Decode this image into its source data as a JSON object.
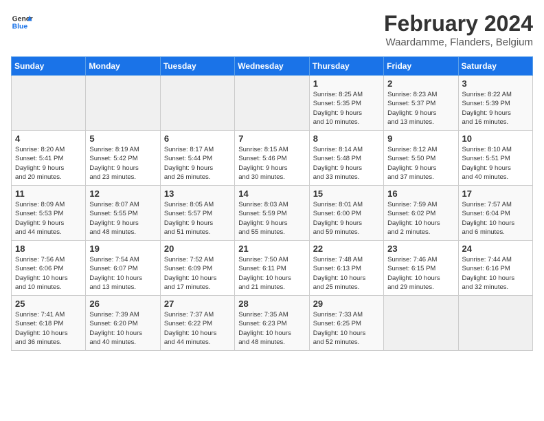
{
  "header": {
    "logo_general": "General",
    "logo_blue": "Blue",
    "title": "February 2024",
    "subtitle": "Waardamme, Flanders, Belgium"
  },
  "calendar": {
    "days_of_week": [
      "Sunday",
      "Monday",
      "Tuesday",
      "Wednesday",
      "Thursday",
      "Friday",
      "Saturday"
    ],
    "weeks": [
      [
        {
          "day": "",
          "info": ""
        },
        {
          "day": "",
          "info": ""
        },
        {
          "day": "",
          "info": ""
        },
        {
          "day": "",
          "info": ""
        },
        {
          "day": "1",
          "info": "Sunrise: 8:25 AM\nSunset: 5:35 PM\nDaylight: 9 hours\nand 10 minutes."
        },
        {
          "day": "2",
          "info": "Sunrise: 8:23 AM\nSunset: 5:37 PM\nDaylight: 9 hours\nand 13 minutes."
        },
        {
          "day": "3",
          "info": "Sunrise: 8:22 AM\nSunset: 5:39 PM\nDaylight: 9 hours\nand 16 minutes."
        }
      ],
      [
        {
          "day": "4",
          "info": "Sunrise: 8:20 AM\nSunset: 5:41 PM\nDaylight: 9 hours\nand 20 minutes."
        },
        {
          "day": "5",
          "info": "Sunrise: 8:19 AM\nSunset: 5:42 PM\nDaylight: 9 hours\nand 23 minutes."
        },
        {
          "day": "6",
          "info": "Sunrise: 8:17 AM\nSunset: 5:44 PM\nDaylight: 9 hours\nand 26 minutes."
        },
        {
          "day": "7",
          "info": "Sunrise: 8:15 AM\nSunset: 5:46 PM\nDaylight: 9 hours\nand 30 minutes."
        },
        {
          "day": "8",
          "info": "Sunrise: 8:14 AM\nSunset: 5:48 PM\nDaylight: 9 hours\nand 33 minutes."
        },
        {
          "day": "9",
          "info": "Sunrise: 8:12 AM\nSunset: 5:50 PM\nDaylight: 9 hours\nand 37 minutes."
        },
        {
          "day": "10",
          "info": "Sunrise: 8:10 AM\nSunset: 5:51 PM\nDaylight: 9 hours\nand 40 minutes."
        }
      ],
      [
        {
          "day": "11",
          "info": "Sunrise: 8:09 AM\nSunset: 5:53 PM\nDaylight: 9 hours\nand 44 minutes."
        },
        {
          "day": "12",
          "info": "Sunrise: 8:07 AM\nSunset: 5:55 PM\nDaylight: 9 hours\nand 48 minutes."
        },
        {
          "day": "13",
          "info": "Sunrise: 8:05 AM\nSunset: 5:57 PM\nDaylight: 9 hours\nand 51 minutes."
        },
        {
          "day": "14",
          "info": "Sunrise: 8:03 AM\nSunset: 5:59 PM\nDaylight: 9 hours\nand 55 minutes."
        },
        {
          "day": "15",
          "info": "Sunrise: 8:01 AM\nSunset: 6:00 PM\nDaylight: 9 hours\nand 59 minutes."
        },
        {
          "day": "16",
          "info": "Sunrise: 7:59 AM\nSunset: 6:02 PM\nDaylight: 10 hours\nand 2 minutes."
        },
        {
          "day": "17",
          "info": "Sunrise: 7:57 AM\nSunset: 6:04 PM\nDaylight: 10 hours\nand 6 minutes."
        }
      ],
      [
        {
          "day": "18",
          "info": "Sunrise: 7:56 AM\nSunset: 6:06 PM\nDaylight: 10 hours\nand 10 minutes."
        },
        {
          "day": "19",
          "info": "Sunrise: 7:54 AM\nSunset: 6:07 PM\nDaylight: 10 hours\nand 13 minutes."
        },
        {
          "day": "20",
          "info": "Sunrise: 7:52 AM\nSunset: 6:09 PM\nDaylight: 10 hours\nand 17 minutes."
        },
        {
          "day": "21",
          "info": "Sunrise: 7:50 AM\nSunset: 6:11 PM\nDaylight: 10 hours\nand 21 minutes."
        },
        {
          "day": "22",
          "info": "Sunrise: 7:48 AM\nSunset: 6:13 PM\nDaylight: 10 hours\nand 25 minutes."
        },
        {
          "day": "23",
          "info": "Sunrise: 7:46 AM\nSunset: 6:15 PM\nDaylight: 10 hours\nand 29 minutes."
        },
        {
          "day": "24",
          "info": "Sunrise: 7:44 AM\nSunset: 6:16 PM\nDaylight: 10 hours\nand 32 minutes."
        }
      ],
      [
        {
          "day": "25",
          "info": "Sunrise: 7:41 AM\nSunset: 6:18 PM\nDaylight: 10 hours\nand 36 minutes."
        },
        {
          "day": "26",
          "info": "Sunrise: 7:39 AM\nSunset: 6:20 PM\nDaylight: 10 hours\nand 40 minutes."
        },
        {
          "day": "27",
          "info": "Sunrise: 7:37 AM\nSunset: 6:22 PM\nDaylight: 10 hours\nand 44 minutes."
        },
        {
          "day": "28",
          "info": "Sunrise: 7:35 AM\nSunset: 6:23 PM\nDaylight: 10 hours\nand 48 minutes."
        },
        {
          "day": "29",
          "info": "Sunrise: 7:33 AM\nSunset: 6:25 PM\nDaylight: 10 hours\nand 52 minutes."
        },
        {
          "day": "",
          "info": ""
        },
        {
          "day": "",
          "info": ""
        }
      ]
    ]
  }
}
